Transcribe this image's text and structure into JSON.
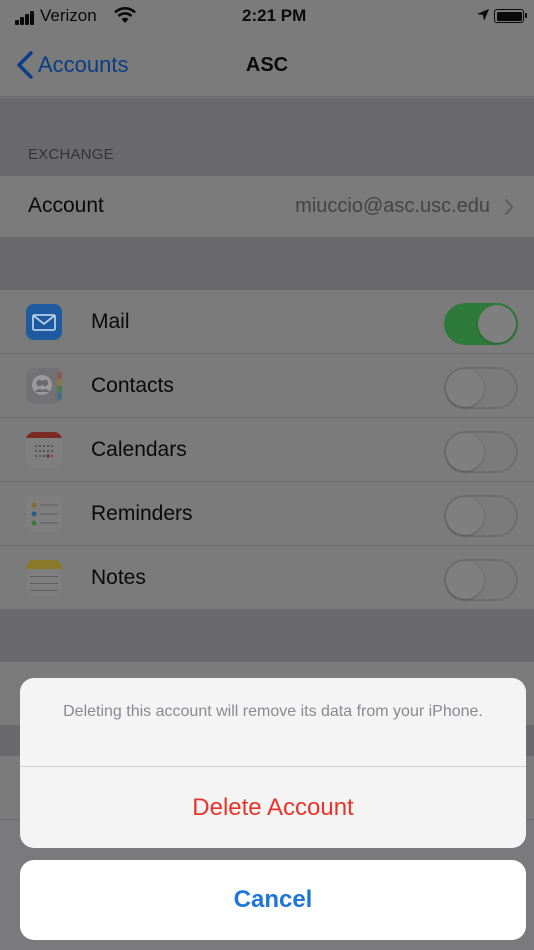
{
  "status_bar": {
    "carrier": "Verizon",
    "time": "2:21 PM",
    "icons": [
      "signal-icon",
      "wifi-icon",
      "location-icon",
      "battery-icon"
    ]
  },
  "nav": {
    "back_label": "Accounts",
    "title": "ASC"
  },
  "section": {
    "header": "EXCHANGE",
    "account_label": "Account",
    "account_value": "miuccio@asc.usc.edu"
  },
  "services": [
    {
      "label": "Mail",
      "icon": "mail-icon",
      "enabled": true
    },
    {
      "label": "Contacts",
      "icon": "contacts-icon",
      "enabled": false
    },
    {
      "label": "Calendars",
      "icon": "calendars-icon",
      "enabled": false
    },
    {
      "label": "Reminders",
      "icon": "reminders-icon",
      "enabled": false
    },
    {
      "label": "Notes",
      "icon": "notes-icon",
      "enabled": false
    }
  ],
  "action_sheet": {
    "message": "Deleting this account will remove its data from your iPhone.",
    "delete_label": "Delete Account",
    "cancel_label": "Cancel"
  },
  "colors": {
    "accent": "#1f76d9",
    "destructive": "#e8342b",
    "toggle_on": "#34c759",
    "dim_overlay": "#7b7b7c"
  }
}
